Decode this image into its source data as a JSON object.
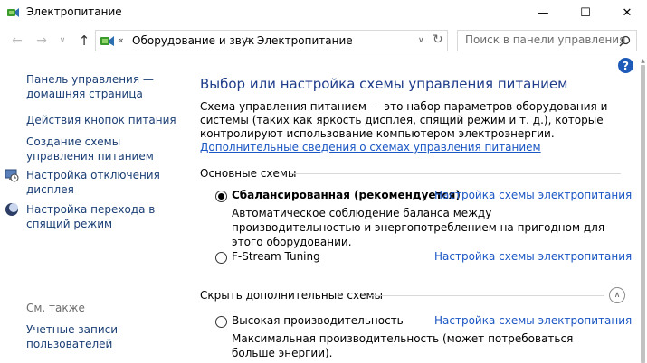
{
  "window": {
    "title": "Электропитание",
    "minimize_glyph": "—",
    "maximize_glyph": "☐",
    "close_glyph": "✕"
  },
  "nav": {
    "back_glyph": "←",
    "forward_glyph": "→",
    "dropdown_glyph": "∨",
    "up_glyph": "↑"
  },
  "address": {
    "overflow": "«",
    "crumbs": [
      "Оборудование и звук",
      "Электропитание"
    ],
    "separator": ">",
    "dropdown_glyph": "∨",
    "refresh_glyph": "↻"
  },
  "search": {
    "placeholder": "Поиск в панели управления"
  },
  "help": {
    "label": "?"
  },
  "sidebar": {
    "home_link": "Панель управления — домашняя страница",
    "links": [
      "Действия кнопок питания",
      "Создание схемы управления питанием",
      "Настройка отключения дисплея",
      "Настройка перехода в спящий режим"
    ],
    "see_also_heading": "См. также",
    "see_also_links": [
      "Учетные записи пользователей"
    ]
  },
  "main": {
    "title": "Выбор или настройка схемы управления питанием",
    "description": "Схема управления питанием — это набор параметров оборудования и системы (таких как яркость дисплея, спящий режим и т. д.), которые контролируют использование компьютером электроэнергии.",
    "more_info_link": "Дополнительные сведения о схемах управления питанием",
    "primary_section": "Основные схемы",
    "hidden_section": "Скрыть дополнительные схемы",
    "plans": [
      {
        "name": "Сбалансированная (рекомендуется)",
        "selected": true,
        "settings_link": "Настройка схемы электропитания",
        "description": "Автоматическое соблюдение баланса между производительностью и энергопотреблением на пригодном для этого оборудовании."
      },
      {
        "name": "F-Stream Tuning",
        "selected": false,
        "settings_link": "Настройка схемы электропитания",
        "description": ""
      },
      {
        "name": "Высокая производительность",
        "selected": false,
        "settings_link": "Настройка схемы электропитания",
        "description": "Максимальная производительность (может потребоваться больше энергии)."
      }
    ],
    "collapse_glyph": "∧"
  }
}
